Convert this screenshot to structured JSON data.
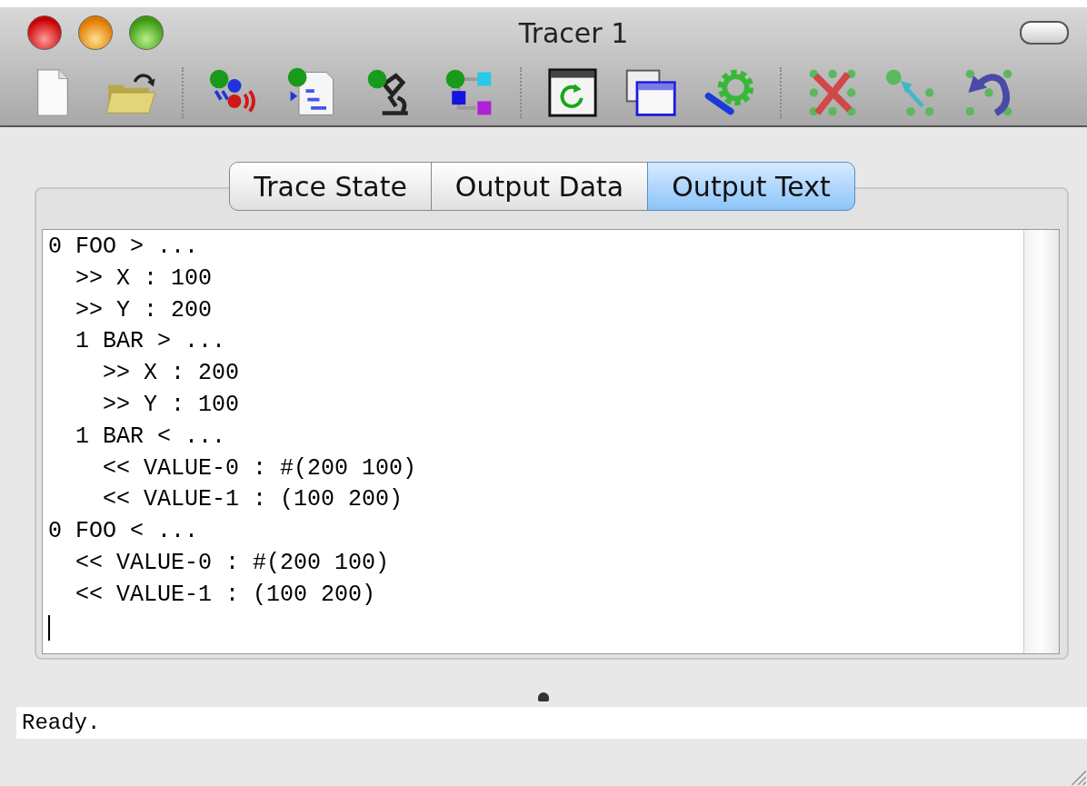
{
  "window": {
    "title": "Tracer 1"
  },
  "tabs": [
    {
      "label": "Trace State",
      "selected": false
    },
    {
      "label": "Output Data",
      "selected": false
    },
    {
      "label": "Output Text",
      "selected": true
    }
  ],
  "output_text": {
    "lines": [
      "0 FOO > ...",
      "  >> X : 100",
      "  >> Y : 200",
      "  1 BAR > ...",
      "    >> X : 200",
      "    >> Y : 100",
      "  1 BAR < ...",
      "    << VALUE-0 : #(200 100)",
      "    << VALUE-1 : (100 200)",
      "0 FOO < ...",
      "  << VALUE-0 : #(200 100)",
      "  << VALUE-1 : (100 200)"
    ]
  },
  "status_bar": {
    "text": "Ready."
  }
}
